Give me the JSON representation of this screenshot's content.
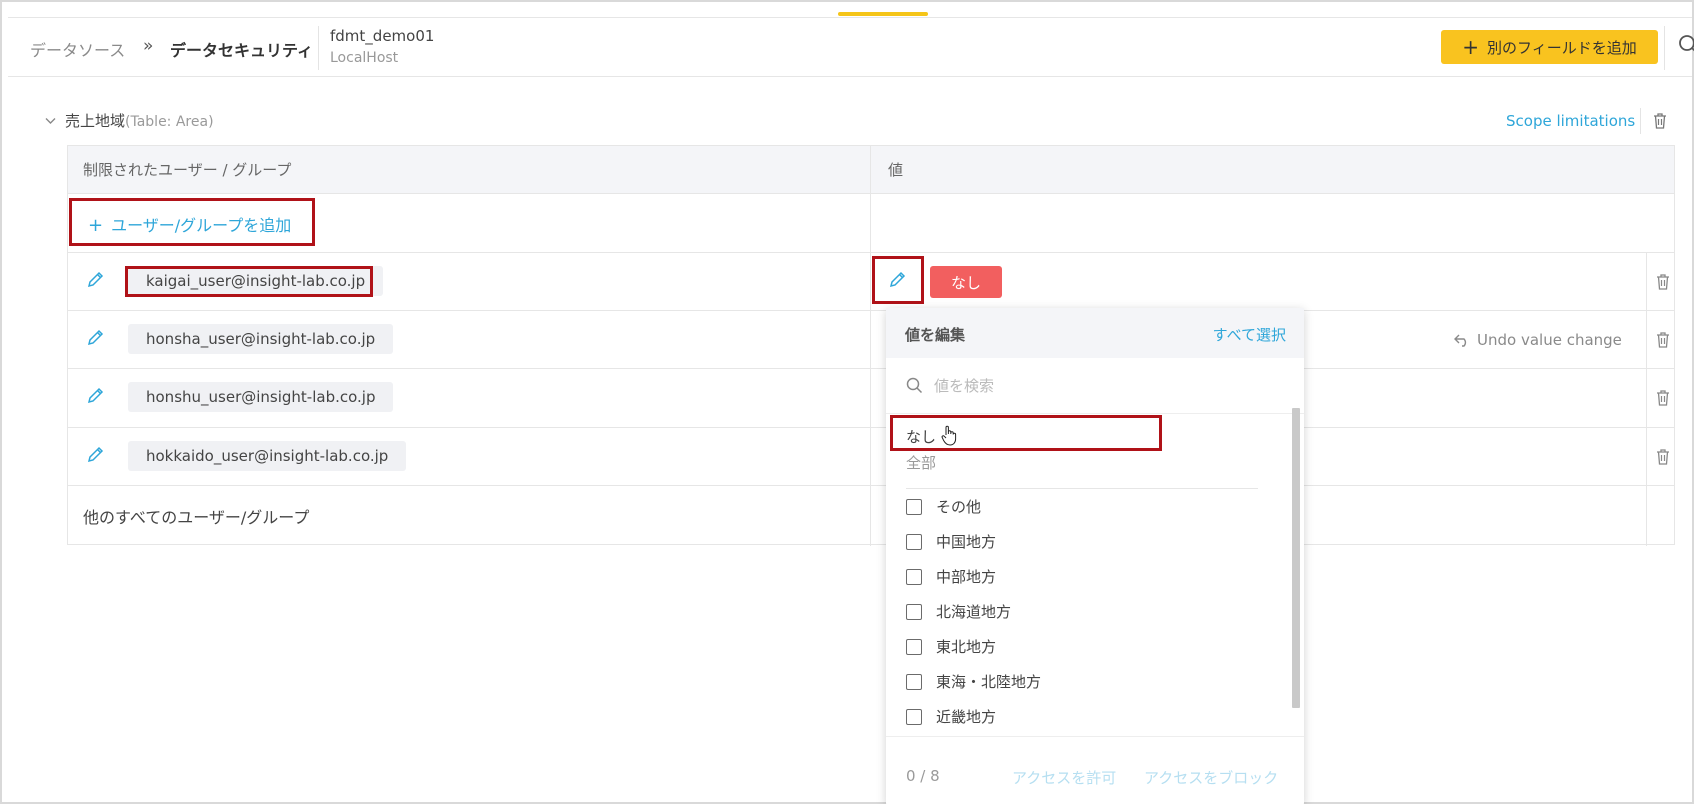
{
  "breadcrumb": {
    "root": "データソース",
    "separator": "»",
    "current": "データセキュリティ"
  },
  "datasource": {
    "name": "fdmt_demo01",
    "host": "LocalHost"
  },
  "header": {
    "add_field_label": "別のフィールドを追加"
  },
  "section": {
    "title": "売上地域",
    "table_tag": "(Table: Area)",
    "scope_link": "Scope limitations"
  },
  "table": {
    "col_user": "制限されたユーザー / グループ",
    "col_value": "値",
    "add_group_label": "ユーザー/グループを追加",
    "rows": [
      {
        "user": "kaigai_user@insight-lab.co.jp",
        "value": "なし"
      },
      {
        "user": "honsha_user@insight-lab.co.jp",
        "undo": "Undo value change"
      },
      {
        "user": "honshu_user@insight-lab.co.jp"
      },
      {
        "user": "hokkaido_user@insight-lab.co.jp"
      }
    ],
    "other_users": "他のすべてのユーザー/グループ"
  },
  "dropdown": {
    "title": "値を編集",
    "select_all": "すべて選択",
    "search_placeholder": "値を検索",
    "nashi": "なし",
    "all": "全部",
    "options": [
      "その他",
      "中国地方",
      "中部地方",
      "北海道地方",
      "東北地方",
      "東海・北陸地方",
      "近畿地方"
    ],
    "count": "0 / 8",
    "allow_label": "アクセスを許可",
    "block_label": "アクセスをブロック"
  },
  "colors": {
    "accent": "#2ea6d9",
    "primary_button": "#f9c31f",
    "badge_red": "#f25f5f",
    "highlight": "#b01218"
  }
}
